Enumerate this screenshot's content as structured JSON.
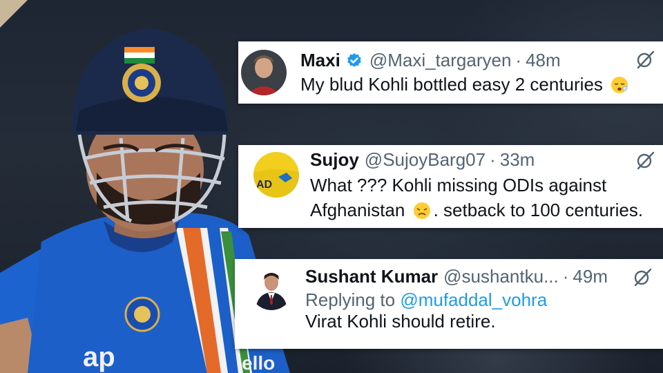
{
  "tweets": [
    {
      "name": "Maxi",
      "handle": "@Maxi_targaryen",
      "separator": "·",
      "time": "48m",
      "verified": true,
      "text": "My blud Kohli bottled easy 2 centuries",
      "emoji": "sleepy-face-icon"
    },
    {
      "name": "Sujoy",
      "handle": "@SujoyBarg07",
      "separator": "·",
      "time": "33m",
      "text_before": "What ??? Kohli missing ODIs against Afghanistan",
      "text_after": ". setback to 100 centuries.",
      "emoji": "disappointed-face-icon"
    },
    {
      "name": "Sushant Kumar",
      "handle": "@sushantku...",
      "separator": "·",
      "time": "49m",
      "reply_prefix": "Replying to",
      "reply_mention": "@mufaddal_vohra",
      "text": "Virat Kohli should retire."
    }
  ],
  "colors": {
    "verified_blue": "#1d9bf0",
    "text_primary": "#0f1419",
    "text_secondary": "#536471",
    "jersey_blue": "#1c5fc8",
    "helmet_navy": "#1b2a4a"
  }
}
